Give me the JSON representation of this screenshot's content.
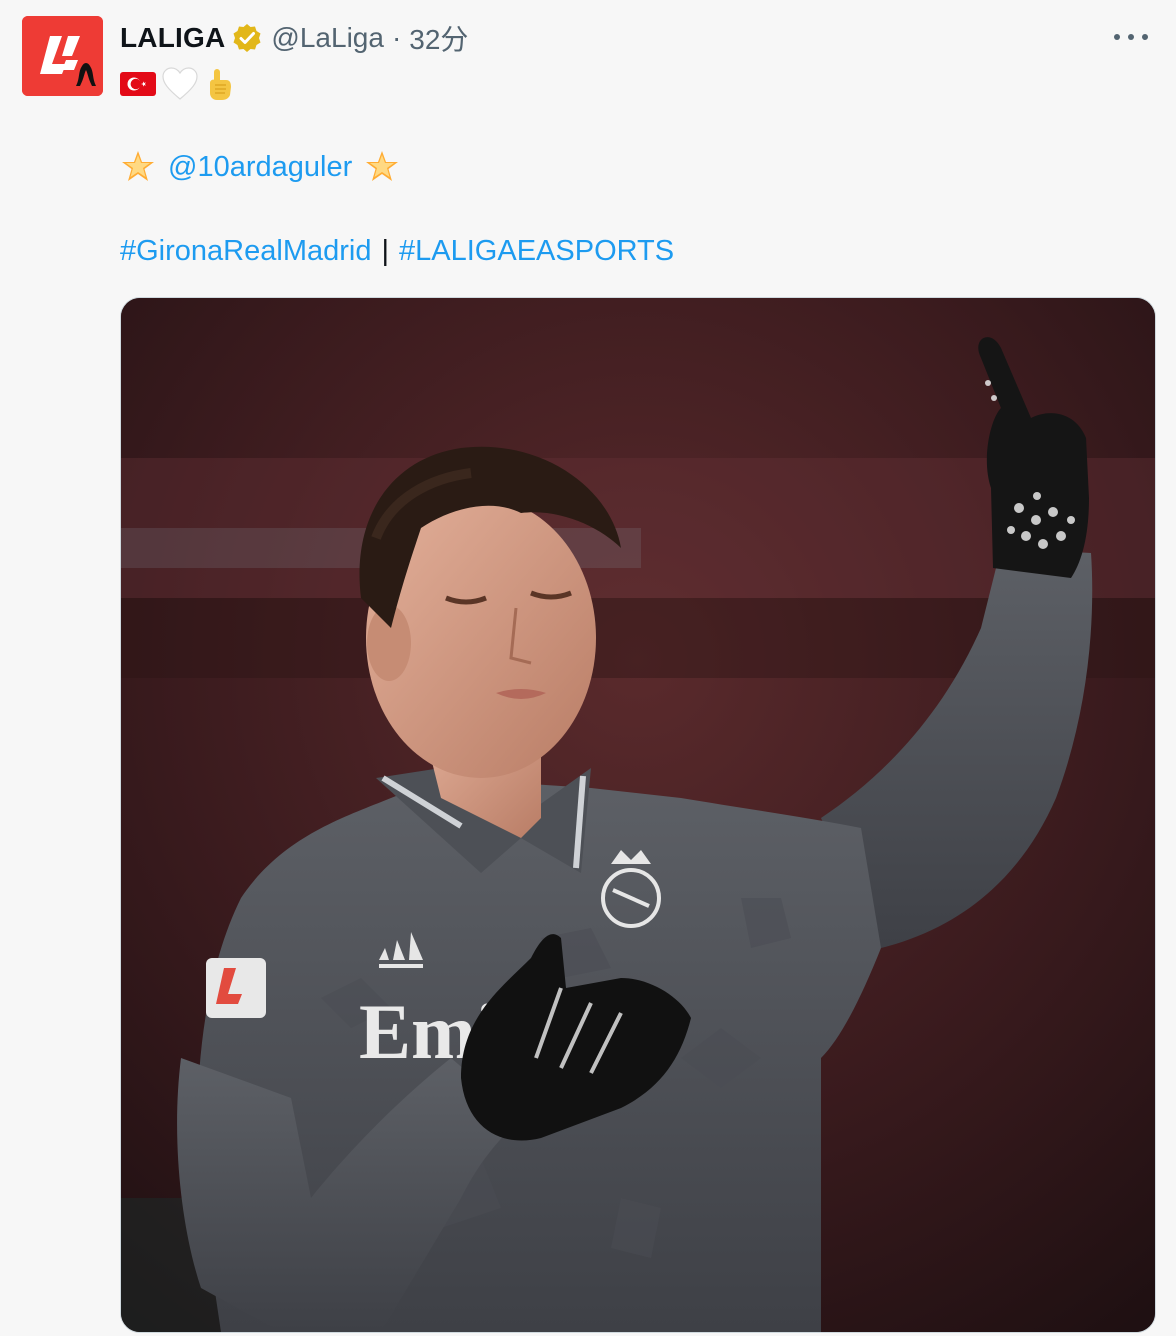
{
  "account": {
    "display_name": "LALIGA",
    "handle": "@LaLiga",
    "separator": "·",
    "time_ago": "32分",
    "avatar_icon": "laliga-logo-icon",
    "verified_icon": "verified-gold-badge-icon"
  },
  "tweet": {
    "emoji_line": [
      "turkey-flag-emoji",
      "white-heart-emoji",
      "pointing-up-emoji"
    ],
    "mention": "@10ardaguler",
    "hashtag_1": "#GironaRealMadrid",
    "separator": "|",
    "hashtag_2": "#LALIGAEASPORTS"
  },
  "media": {
    "alt": "Player in dark grey kit, eyes closed, left hand over heart, right index finger raised",
    "shirt_text": "Emi"
  },
  "colors": {
    "link": "#1d9bf0",
    "secondary_text": "#536471",
    "avatar_bg": "#ee3b35",
    "verified_gold": "#e2b719"
  }
}
